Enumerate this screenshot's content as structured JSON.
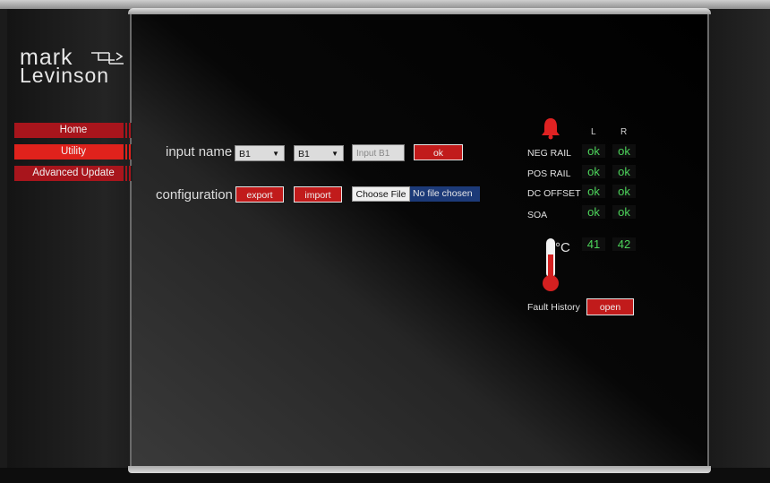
{
  "brand": {
    "line1": "mark",
    "line2": "Levinson",
    "logo_icon": "levinson-arrow-mark"
  },
  "nav": {
    "items": [
      {
        "label": "Home",
        "active": false
      },
      {
        "label": "Utility",
        "active": true
      },
      {
        "label": "Advanced Update",
        "active": false
      }
    ]
  },
  "input_name": {
    "label": "input name",
    "select1": "B1",
    "select2": "B1",
    "text_placeholder": "Input B1",
    "ok_label": "ok"
  },
  "configuration": {
    "label": "configuration",
    "export_label": "export",
    "import_label": "import",
    "file_button": "Choose File",
    "file_status": "No file chosen"
  },
  "status": {
    "alarm_icon": "bell-icon",
    "columns": [
      "L",
      "R"
    ],
    "rows": [
      {
        "label": "NEG RAIL",
        "l": "ok",
        "r": "ok"
      },
      {
        "label": "POS RAIL",
        "l": "ok",
        "r": "ok"
      },
      {
        "label": "DC OFFSET",
        "l": "ok",
        "r": "ok"
      },
      {
        "label": "SOA",
        "l": "ok",
        "r": "ok"
      }
    ],
    "temp_unit": "°C",
    "temp_l": "41",
    "temp_r": "42",
    "fault_label": "Fault History",
    "fault_button": "open"
  },
  "colors": {
    "accent_red": "#c11b1b",
    "ok_green": "#4cd35a",
    "file_blue": "#1c3a78"
  }
}
